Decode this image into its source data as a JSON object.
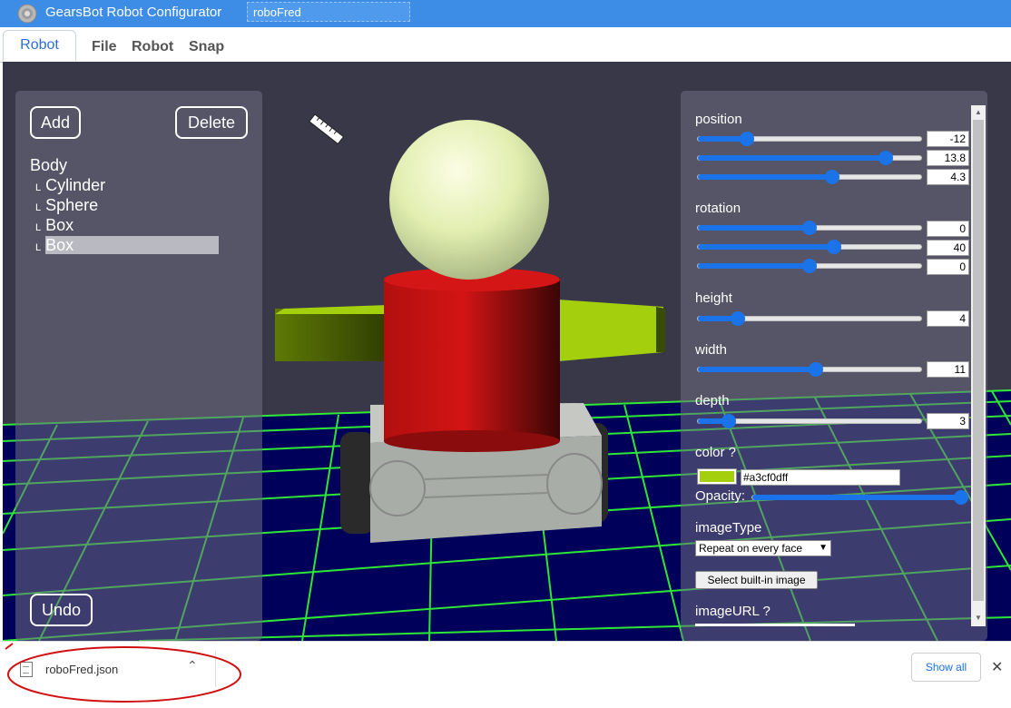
{
  "titlebar": {
    "title": "GearsBot Robot Configurator",
    "robot_name": "roboFred"
  },
  "menu": {
    "tab": "Robot",
    "items": [
      "File",
      "Robot",
      "Snap"
    ]
  },
  "left_panel": {
    "add_label": "Add",
    "delete_label": "Delete",
    "undo_label": "Undo",
    "tree": {
      "root": "Body",
      "branch_marker": "L",
      "children": [
        "Cylinder",
        "Sphere",
        "Box",
        "Box"
      ],
      "selected_index": 3
    }
  },
  "properties": {
    "position_label": "position",
    "position": [
      {
        "value": "-12",
        "slider_fraction": 0.22
      },
      {
        "value": "13.8",
        "slider_fraction": 0.84
      },
      {
        "value": "4.3",
        "slider_fraction": 0.6
      }
    ],
    "rotation_label": "rotation",
    "rotation": [
      {
        "value": "0",
        "slider_fraction": 0.5
      },
      {
        "value": "40",
        "slider_fraction": 0.61
      },
      {
        "value": "0",
        "slider_fraction": 0.5
      }
    ],
    "height_label": "height",
    "height": {
      "value": "4",
      "slider_fraction": 0.18
    },
    "width_label": "width",
    "width": {
      "value": "11",
      "slider_fraction": 0.53
    },
    "depth_label": "depth",
    "depth": {
      "value": "3",
      "slider_fraction": 0.14
    },
    "color_label": "color ?",
    "color_value": "#a3cf0dff",
    "color_swatch": "#a3cf0d",
    "opacity_label": "Opacity:",
    "opacity_fraction": 1.0,
    "imagetype_label": "imageType",
    "imagetype_selected": "Repeat on every face",
    "builtin_button": "Select built-in image",
    "imageurl_label": "imageURL ?"
  },
  "download_bar": {
    "filename": "roboFred.json",
    "show_all": "Show all",
    "close_glyph": "✕",
    "chevron_glyph": "⌃"
  },
  "icons": {
    "app": "gear-icon",
    "ruler": "ruler-icon",
    "file": "file-icon",
    "close": "close-icon",
    "chevron": "chevron-up-icon"
  },
  "colors": {
    "titlebar": "#3d8de6",
    "accent": "#1a73e8",
    "grid": "#33ff33",
    "body_cylinder": "#cc1111",
    "arms": "#a3cf0d",
    "sphere": "#eef5c0"
  }
}
